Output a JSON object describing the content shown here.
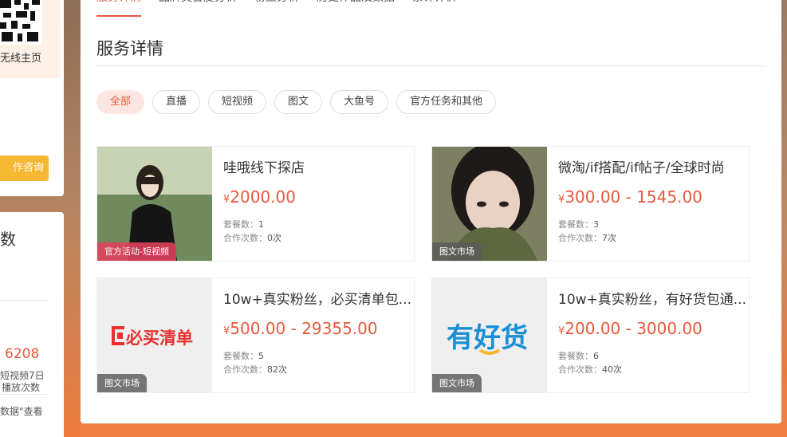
{
  "left": {
    "qr_label": "无线主页",
    "consult_label": "作咨询",
    "stat_title": "数",
    "stat_number": "6208",
    "stat_sub1": "短视频7日",
    "stat_sub2": "播放次数",
    "stat_sub3": "数据\"查看"
  },
  "tabs": [
    {
      "label": "服务详情"
    },
    {
      "label": "品牌契合度分析"
    },
    {
      "label": "粉丝分析"
    },
    {
      "label": "历史作品及数据"
    },
    {
      "label": "累计评价"
    }
  ],
  "section_title": "服务详情",
  "filters": [
    {
      "label": "全部",
      "active": true
    },
    {
      "label": "直播"
    },
    {
      "label": "短视频"
    },
    {
      "label": "图文"
    },
    {
      "label": "大鱼号"
    },
    {
      "label": "官方任务和其他"
    }
  ],
  "meta_labels": {
    "packages": "套餐数：",
    "cooperations": "合作次数："
  },
  "cards": [
    {
      "name": "哇哦线下探店",
      "currency": "¥",
      "price": "2000.00",
      "packages": "1",
      "cooperations": "0次",
      "badge": "官方活动-短视频",
      "thumb_icon": "woman-portrait-photo"
    },
    {
      "name": "微淘/if搭配/if帖子/全球时尚",
      "currency": "¥",
      "price": "300.00 - 1545.00",
      "packages": "3",
      "cooperations": "7次",
      "badge": "图文市场",
      "thumb_icon": "woman-closeup-photo"
    },
    {
      "name": "10w+真实粉丝，必买清单包...",
      "currency": "¥",
      "price": "500.00 - 29355.00",
      "packages": "5",
      "cooperations": "82次",
      "badge": "图文市场",
      "logo_text": "必买清单",
      "thumb_icon": "bimai-qingdan-logo"
    },
    {
      "name": "10w+真实粉丝，有好货包通...",
      "currency": "¥",
      "price": "200.00 - 3000.00",
      "packages": "6",
      "cooperations": "40次",
      "badge": "图文市场",
      "logo_text": "有好货",
      "thumb_icon": "youhaohuo-logo"
    }
  ],
  "colors": {
    "accent": "#e8593b",
    "consult": "#f5b833",
    "logo_red": "#e8302f",
    "logo_blue": "#1a8fd6"
  }
}
